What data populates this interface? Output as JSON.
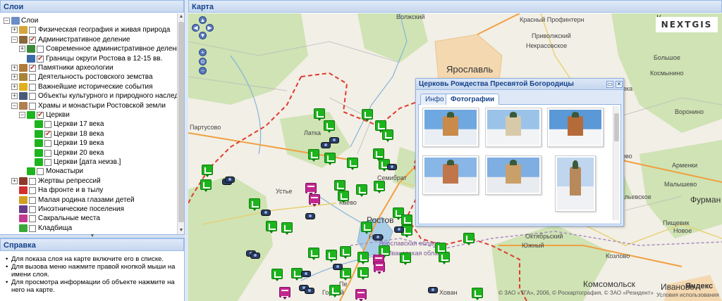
{
  "left_panel": {
    "title": "Слои",
    "tree": [
      {
        "label": "Слои",
        "level": 0,
        "icon": "layers-icon",
        "expander": "minus",
        "checkbox": null
      },
      {
        "label": "Физическая география и живая природа",
        "level": 1,
        "icon": "globe-icon",
        "expander": "plus",
        "checkbox": false
      },
      {
        "label": "Административное деление",
        "level": 1,
        "icon": "admin-icon",
        "expander": "minus",
        "checkbox": true
      },
      {
        "label": "Современное административное деление",
        "level": 2,
        "icon": "map-icon",
        "expander": "plus",
        "checkbox": false
      },
      {
        "label": "Границы округи Ростова в 12-15 вв.",
        "level": 2,
        "icon": "border-icon",
        "expander": null,
        "checkbox": true
      },
      {
        "label": "Памятники археологии",
        "level": 1,
        "icon": "archaeology-icon",
        "expander": "plus",
        "checkbox": true
      },
      {
        "label": "Деятельность ростовского земства",
        "level": 1,
        "icon": "book-icon",
        "expander": "plus",
        "checkbox": false
      },
      {
        "label": "Важнейшие исторические события",
        "level": 1,
        "icon": "warning-icon",
        "expander": "plus",
        "checkbox": false
      },
      {
        "label": "Объекты культурного и природного наследия",
        "level": 1,
        "icon": "heritage-icon",
        "expander": "plus",
        "checkbox": false
      },
      {
        "label": "Храмы и монастыри Ростовской земли",
        "level": 1,
        "icon": "church-icon",
        "expander": "minus",
        "checkbox": false
      },
      {
        "label": "Церкви",
        "level": 2,
        "icon": "church-green-icon",
        "expander": "minus",
        "checkbox": true
      },
      {
        "label": "Церкви 17 века",
        "level": 3,
        "icon": "church-marker-icon",
        "expander": null,
        "checkbox": false
      },
      {
        "label": "Церкви 18 века",
        "level": 3,
        "icon": "church-marker-icon",
        "expander": null,
        "checkbox": true
      },
      {
        "label": "Церкви 19 века",
        "level": 3,
        "icon": "church-marker-icon",
        "expander": null,
        "checkbox": false
      },
      {
        "label": "Церкви 20 века",
        "level": 3,
        "icon": "church-marker-icon",
        "expander": null,
        "checkbox": false
      },
      {
        "label": "Церкви [дата неизв.]",
        "level": 3,
        "icon": "church-marker-icon",
        "expander": null,
        "checkbox": false
      },
      {
        "label": "Монастыри",
        "level": 2,
        "icon": "monastery-icon",
        "expander": null,
        "checkbox": false
      },
      {
        "label": "Жертвы репрессий",
        "level": 1,
        "icon": "cross-icon",
        "expander": "plus",
        "checkbox": false
      },
      {
        "label": "На фронте и в тылу",
        "level": 1,
        "icon": "flag-icon",
        "expander": null,
        "checkbox": false
      },
      {
        "label": "Малая родина глазами детей",
        "level": 1,
        "icon": "children-icon",
        "expander": null,
        "checkbox": false
      },
      {
        "label": "Иноэтнические поселения",
        "level": 1,
        "icon": "settlement-icon",
        "expander": null,
        "checkbox": false
      },
      {
        "label": "Сакральные места",
        "level": 1,
        "icon": "sacred-icon",
        "expander": null,
        "checkbox": false
      },
      {
        "label": "Кладбища",
        "level": 1,
        "icon": "cemetery-icon",
        "expander": null,
        "checkbox": false
      }
    ]
  },
  "help_panel": {
    "title": "Справка",
    "items": [
      "Для показа слоя на карте включите его в списке.",
      "Для вызова меню нажмите правой кнопкой мыши на имени слоя.",
      "Для просмотра информации об объекте нажмите на него на карте."
    ]
  },
  "map_panel": {
    "title": "Карта",
    "labels": {
      "yaroslavl": "Ярославль",
      "rostov": "Ростов",
      "komsomolsk": "Комсомольск",
      "ivanovo": "Иваново",
      "furmanov": "Фурман",
      "k_top": "К",
      "semibratovo": "Семибрат",
      "latka": "Латка",
      "partusovo": "Партусово",
      "kaevo": "Каево",
      "nero": "Неро",
      "kr_profintern": "Красный Профинтерн",
      "volzhsky": "Волжский",
      "privolzhsky": "Приволжский",
      "nekrasovskoe": "Некрасовское",
      "bolshoye": "Большое",
      "kosmynino": "Космынино",
      "armenki": "Арменки",
      "oktyabrsky": "Октябрьский",
      "yuzhny": "Южный",
      "voronino": "Воронино",
      "malyshevo": "Малышево",
      "pishchevik": "Пищевик",
      "novoe": "Новое",
      "yaroslavskaya_obl": "Ярославская область",
      "ivanovskaya_obl": "Ивановская область",
      "gorny": "Горный",
      "pe": "Пе",
      "ussya": "Устье",
      "lokhovka": "Лоховка",
      "chusovo": "Чусово",
      "vasilyevskoye": "Васильевское",
      "kozlovo": "Козлово",
      "khovan": "Хован"
    },
    "logo": "NEXTGIS",
    "copyright": "© ЗАО «ТГА», 2006, © Роскартография, © ЗАО «Резидент»",
    "yandex": "Яндекс",
    "yandex_terms": "Условия использования"
  },
  "popup": {
    "title": "Церковь Рождества Пресвятой Богородицы",
    "tabs": [
      {
        "label": "Инфо",
        "active": false
      },
      {
        "label": "Фотографии",
        "active": true
      }
    ],
    "photos": [
      {
        "name": "church-photo-1",
        "sky": "#6fa7e0",
        "ground": "#e9eef4",
        "building": "#c98a4a"
      },
      {
        "name": "church-photo-2",
        "sky": "#9bc3ea",
        "ground": "#f1f3f5",
        "building": "#d8c9a8"
      },
      {
        "name": "church-photo-3",
        "sky": "#5b98d6",
        "ground": "#f4f5f7",
        "building": "#b56a3a"
      },
      {
        "name": "church-photo-4",
        "sky": "#88b6e6",
        "ground": "#eef0f3",
        "building": "#c0764a"
      },
      {
        "name": "church-photo-5",
        "sky": "#7faee2",
        "ground": "#e8ebef",
        "building": "#caa06a"
      },
      {
        "name": "church-photo-6",
        "sky": "#c0d6ef",
        "ground": "#eff1f4",
        "building": "#b8895a"
      }
    ],
    "close_label": "✕",
    "dock_label": "▭"
  },
  "colors": {
    "header_text": "#15428b",
    "church_marker": "#1db41d",
    "monastery_marker": "#c2278f",
    "region_border": "#e03a2f"
  }
}
